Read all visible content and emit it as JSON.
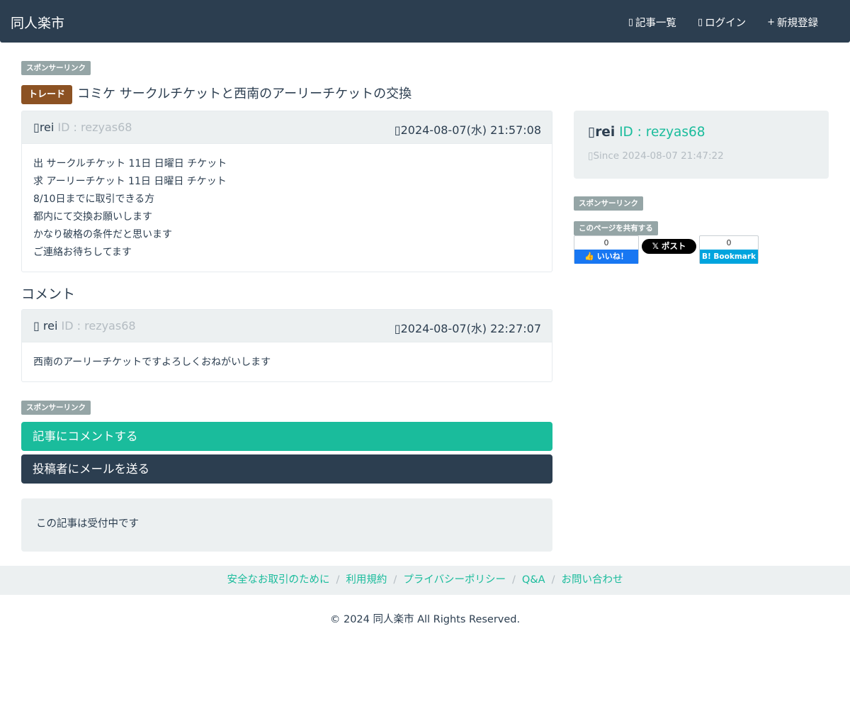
{
  "navbar": {
    "brand": "同人楽市",
    "links": [
      {
        "icon": "list-icon",
        "glyph": "▯",
        "label": "記事一覧"
      },
      {
        "icon": "login-icon",
        "glyph": "▯",
        "label": "ログイン"
      },
      {
        "icon": "plus-icon",
        "glyph": "+",
        "label": "新規登録"
      }
    ]
  },
  "ads": {
    "sponsor_label": "スポンサーリンク",
    "share_label": "このページを共有する"
  },
  "post": {
    "category": "トレード",
    "title": "コミケ サークルチケットと西南のアーリーチケットの交換",
    "author_icon": "▯",
    "author": "rei",
    "author_id": "ID : rezyas68",
    "date_icon": "▯",
    "date": "2024-08-07(水) 21:57:08",
    "body_lines": [
      "出 サークルチケット 11日 日曜日 チケット",
      "求 アーリーチケット 11日 日曜日 チケット",
      "8/10日までに取引できる方",
      "都内にて交換お願いします",
      "かなり破格の条件だと思います",
      "ご連絡お待ちしてます"
    ]
  },
  "comments": {
    "title": "コメント",
    "items": [
      {
        "author_icon": "▯",
        "author": "rei",
        "author_id": "ID : rezyas68",
        "date_icon": "▯",
        "date": "2024-08-07(水) 22:27:07",
        "body": "西南のアーリーチケットですよろしくおねがいします"
      }
    ]
  },
  "actions": {
    "comment_button": "記事にコメントする",
    "mail_button": "投稿者にメールを送る",
    "status": "この記事は受付中です"
  },
  "sidebar": {
    "user_icon": "▯",
    "user": "rei",
    "user_id": "ID : rezyas68",
    "since_icon": "▯",
    "since": "Since 2024-08-07 21:47:22"
  },
  "share": {
    "fb_count": "0",
    "fb_label": "👍 いいね！",
    "x_label": "𝕏 ポスト",
    "hb_count": "0",
    "hb_label": "B! Bookmark"
  },
  "footer": {
    "links": [
      "安全なお取引のために",
      "利用規約",
      "プライバシーポリシー",
      "Q&A",
      "お問い合わせ"
    ],
    "copyright": "© 2024 同人楽市 All Rights Reserved."
  },
  "colors": {
    "navbar": "#2c3e50",
    "accent": "#1abc9c",
    "trade_label": "#8c5223",
    "panel_heading": "#ecf0f1",
    "badge": "#95a5a6"
  }
}
